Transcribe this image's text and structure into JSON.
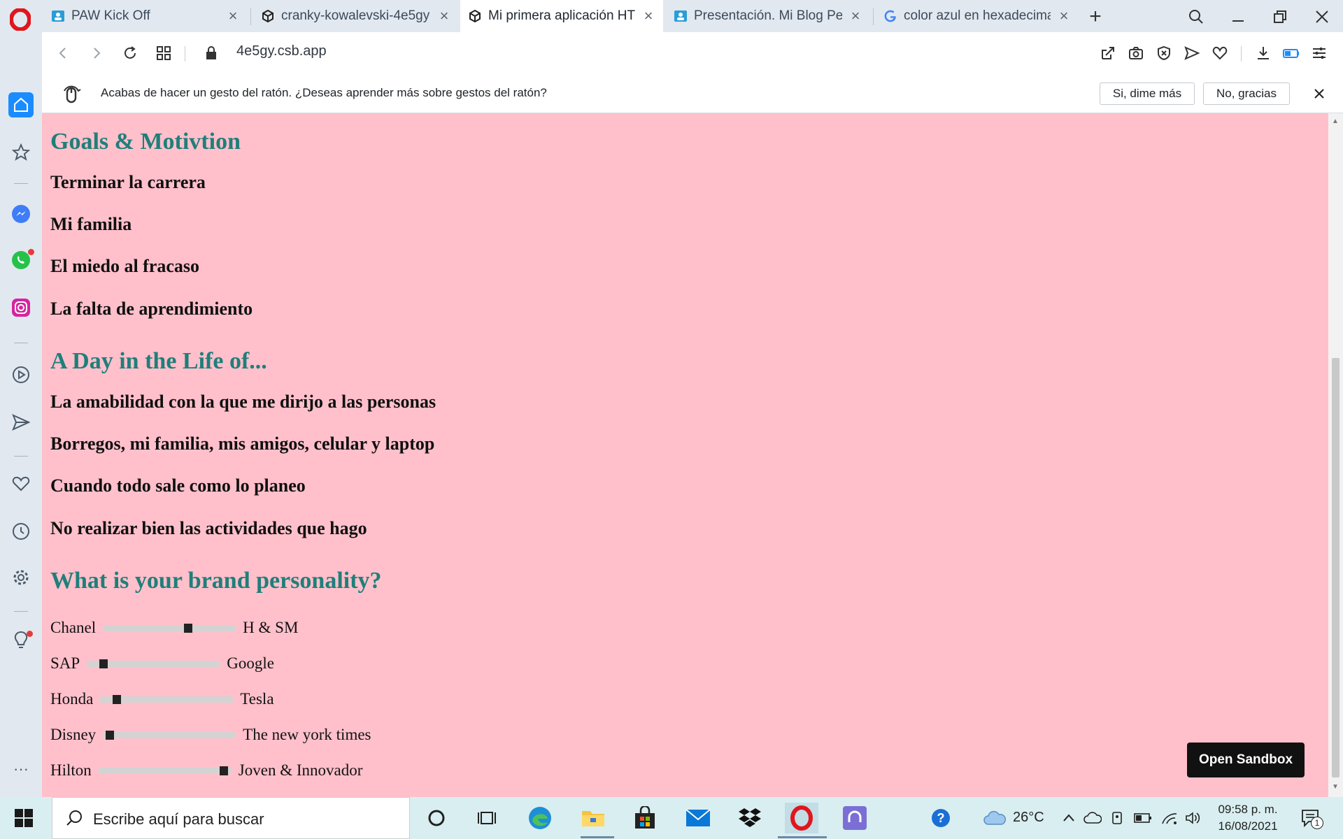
{
  "browser": {
    "tabs": [
      {
        "title": "PAW Kick Off",
        "favicon": "person-card-icon",
        "active": false
      },
      {
        "title": "cranky-kowalevski-4e5gy -",
        "favicon": "codesandbox-cube-icon",
        "active": false
      },
      {
        "title": "Mi primera aplicación HTM",
        "favicon": "codesandbox-cube-icon",
        "active": true
      },
      {
        "title": "Presentación. Mi Blog Perso",
        "favicon": "person-card-icon",
        "active": false
      },
      {
        "title": "color azul en hexadecimal -",
        "favicon": "google-g-icon",
        "active": false
      }
    ],
    "url": "4e5gy.csb.app"
  },
  "notification": {
    "text": "Acabas de hacer un gesto del ratón. ¿Deseas aprender más sobre gestos del ratón?",
    "yes_label": "Si, dime más",
    "no_label": "No, gracias"
  },
  "page": {
    "section1_title": "Goals & Motivtion",
    "section1_items": [
      "Terminar la carrera",
      "Mi familia",
      "El miedo al fracaso",
      "La falta de aprendimiento"
    ],
    "section2_title": "A Day in the Life of...",
    "section2_items": [
      "La amabilidad con la que me dirijo a las personas",
      "Borregos, mi familia, mis amigos, celular y laptop",
      "Cuando todo sale como lo planeo",
      "No realizar bien las actividades que hago"
    ],
    "section3_title": "What is your brand personality?",
    "sliders": [
      {
        "left": "Chanel",
        "right": "H & SM",
        "value": 0.65
      },
      {
        "left": "SAP",
        "right": "Google",
        "value": 0.1
      },
      {
        "left": "Honda",
        "right": "Tesla",
        "value": 0.1
      },
      {
        "left": "Disney",
        "right": "The new york times",
        "value": 0.02
      },
      {
        "left": "Hilton",
        "right": "Joven & Innovador",
        "value": 0.97
      }
    ],
    "open_sandbox_label": "Open Sandbox"
  },
  "taskbar": {
    "search_placeholder": "Escribe aquí para buscar",
    "temperature": "26°C",
    "time": "09:58 p. m.",
    "date": "16/08/2021",
    "notification_count": "1"
  },
  "colors": {
    "page_background": "#ffc0cb",
    "heading_teal": "#1f7f7a",
    "opera_red": "#e0161e",
    "taskbar": "#d9eef0"
  }
}
